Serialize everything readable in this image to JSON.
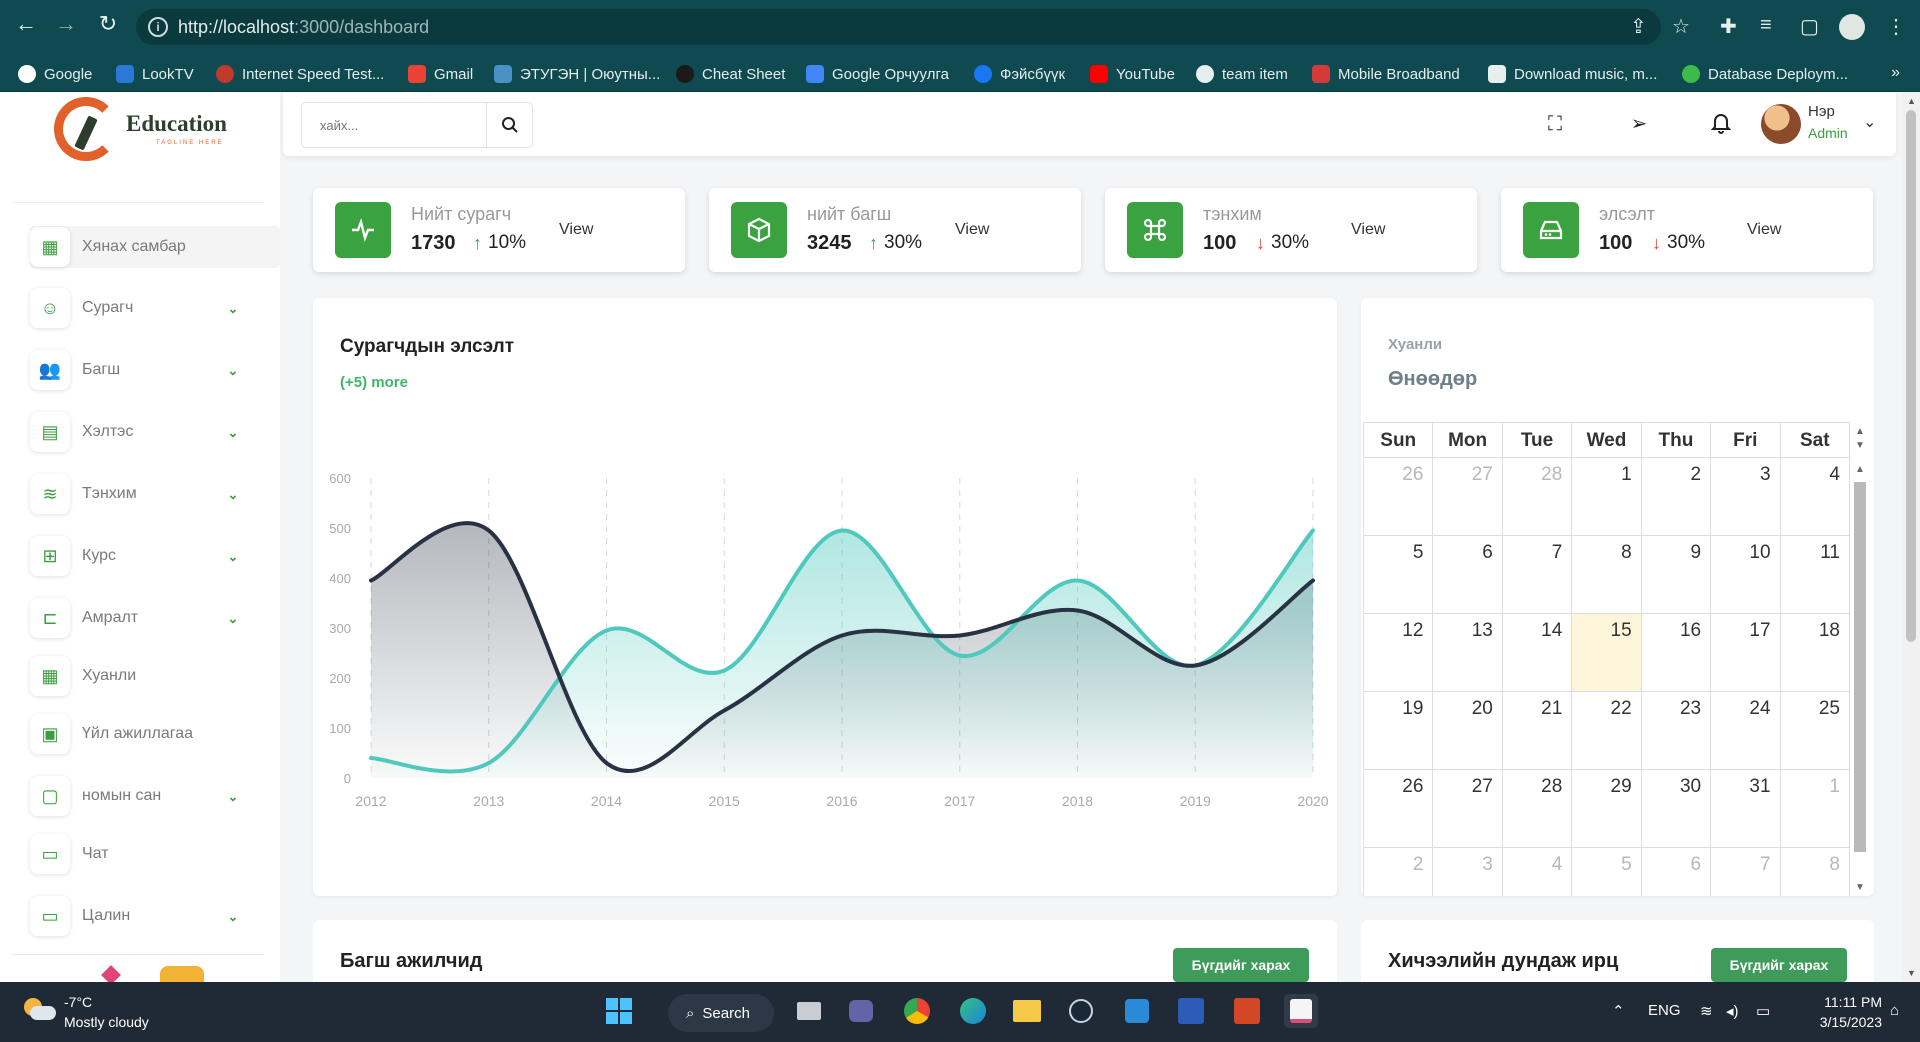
{
  "browser": {
    "url_host": "http://localhost",
    "url_rest": ":3000/dashboard",
    "bookmarks": [
      "Google",
      "LookTV",
      "Internet Speed Test...",
      "Gmail",
      "ЭТУГЭН | Оюутны...",
      "Cheat Sheet",
      "Google Орчуулга",
      "Фэйсбүүк",
      "YouTube",
      "team item",
      "Mobile Broadband",
      "Download music, m...",
      "Database Deploym..."
    ],
    "more": "»"
  },
  "logo": {
    "title": "Education",
    "tagline": "TAGLINE HERE"
  },
  "sidebar": {
    "items": [
      {
        "label": "Хянах самбар",
        "icon": "grid-icon",
        "glyph": "▦",
        "chevron": false,
        "active": true
      },
      {
        "label": "Сурагч",
        "icon": "student-icon",
        "glyph": "☺",
        "chevron": true
      },
      {
        "label": "Багш",
        "icon": "teachers-icon",
        "glyph": "👥",
        "chevron": true
      },
      {
        "label": "Хэлтэс",
        "icon": "building-icon",
        "glyph": "▤",
        "chevron": true
      },
      {
        "label": "Тэнхим",
        "icon": "layers-icon",
        "glyph": "≋",
        "chevron": true
      },
      {
        "label": "Курс",
        "icon": "course-icon",
        "glyph": "⊞",
        "chevron": true
      },
      {
        "label": "Амралт",
        "icon": "bed-icon",
        "glyph": "⊏",
        "chevron": true
      },
      {
        "label": "Хуанли",
        "icon": "calendar-icon",
        "glyph": "▦",
        "chevron": false
      },
      {
        "label": "Үйл ажиллагаа",
        "icon": "event-icon",
        "glyph": "▣",
        "chevron": false
      },
      {
        "label": "номын сан",
        "icon": "library-icon",
        "glyph": "▢",
        "chevron": true
      },
      {
        "label": "Чат",
        "icon": "chat-icon",
        "glyph": "▭",
        "chevron": false
      },
      {
        "label": "Цалин",
        "icon": "wallet-icon",
        "glyph": "▭",
        "chevron": true
      }
    ]
  },
  "topbar": {
    "search_placeholder": "хайх...",
    "user_name": "Нэр",
    "user_role": "Admin"
  },
  "stats": [
    {
      "label": "Нийт сурагч",
      "value": "1730",
      "change": "10%",
      "direction": "up",
      "view": "View",
      "icon": "activity-icon"
    },
    {
      "label": "нийт багш",
      "value": "3245",
      "change": "30%",
      "direction": "up",
      "view": "View",
      "icon": "box-icon"
    },
    {
      "label": "тэнхим",
      "value": "100",
      "change": "30%",
      "direction": "down",
      "view": "View",
      "icon": "command-icon"
    },
    {
      "label": "элсэлт",
      "value": "100",
      "change": "30%",
      "direction": "down",
      "view": "View",
      "icon": "drive-icon"
    }
  ],
  "chart": {
    "title": "Сурагчдын элсэлт",
    "more": "(+5) more"
  },
  "chart_data": {
    "type": "area",
    "x": [
      "2012",
      "2013",
      "2014",
      "2015",
      "2016",
      "2017",
      "2018",
      "2019",
      "2020"
    ],
    "ylim": [
      0,
      600
    ],
    "yticks": [
      0,
      100,
      200,
      300,
      400,
      500,
      600
    ],
    "grid": "vertical dashed",
    "series": [
      {
        "values": [
          40,
          30,
          295,
          215,
          495,
          245,
          395,
          225,
          495
        ],
        "color": "#4fc9bd"
      },
      {
        "values": [
          395,
          495,
          30,
          135,
          285,
          285,
          335,
          225,
          395
        ],
        "color": "#283242"
      }
    ]
  },
  "calendar": {
    "subtitle": "Хуанли",
    "title": "Өнөөдөр",
    "weekdays": [
      "Sun",
      "Mon",
      "Tue",
      "Wed",
      "Thu",
      "Fri",
      "Sat"
    ],
    "weeks": [
      [
        "26",
        "27",
        "28",
        "1",
        "2",
        "3",
        "4"
      ],
      [
        "5",
        "6",
        "7",
        "8",
        "9",
        "10",
        "11"
      ],
      [
        "12",
        "13",
        "14",
        "15",
        "16",
        "17",
        "18"
      ],
      [
        "19",
        "20",
        "21",
        "22",
        "23",
        "24",
        "25"
      ],
      [
        "26",
        "27",
        "28",
        "29",
        "30",
        "31",
        "1"
      ],
      [
        "2",
        "3",
        "4",
        "5",
        "6",
        "7",
        "8"
      ]
    ],
    "today": "15"
  },
  "bottom": {
    "left_title": "Багш ажилчид",
    "left_button": "Бүгдийг харах",
    "right_title": "Хичээлийн дундаж ирц",
    "right_button": "Бүгдийг харах"
  },
  "taskbar": {
    "temp": "-7°C",
    "weather": "Mostly cloudy",
    "search": "Search",
    "lang": "ENG",
    "time": "11:11 PM",
    "date": "3/15/2023"
  },
  "colors": {
    "accent": "#3aa23f",
    "teal": "#4fc9bd",
    "navy": "#283242",
    "today": "#fdf6db"
  }
}
